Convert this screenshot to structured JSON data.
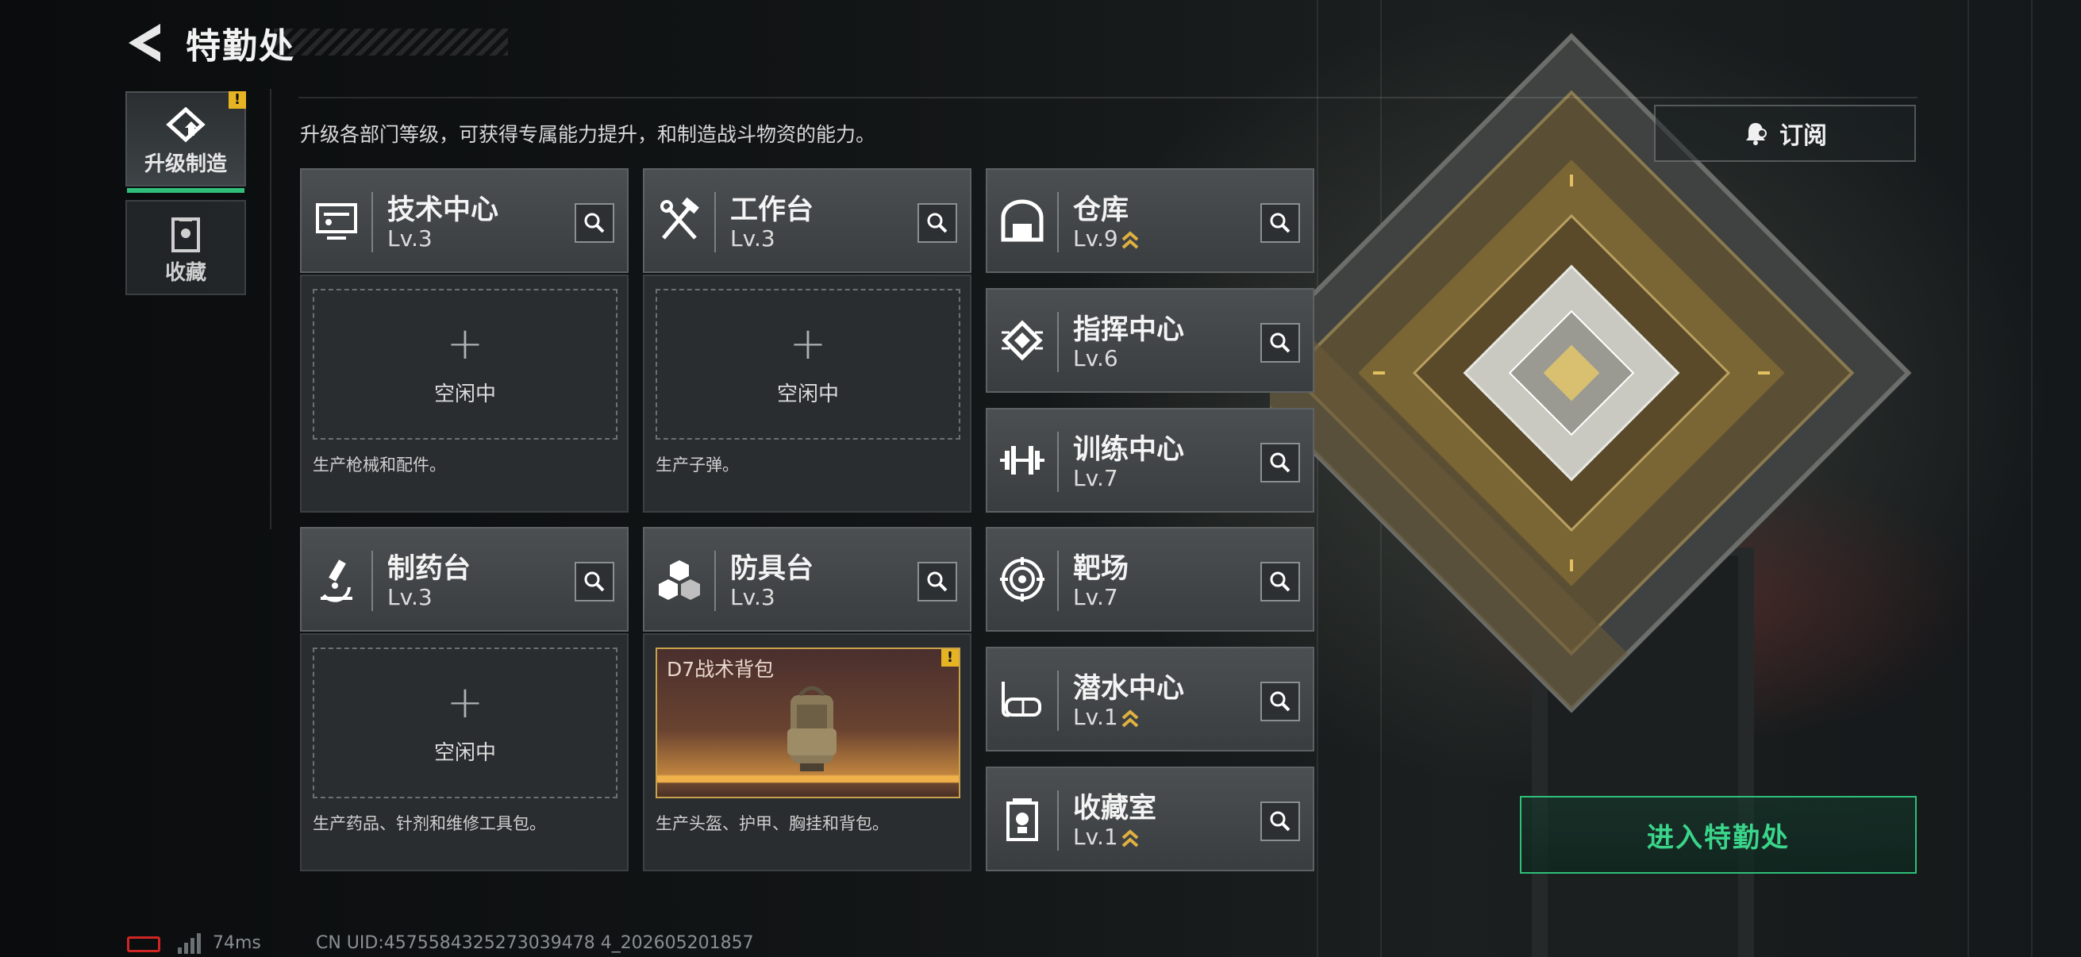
{
  "header": {
    "title": "特勤处"
  },
  "sidebar": {
    "tabs": [
      {
        "label": "升级制造",
        "active": true,
        "badge": "!"
      },
      {
        "label": "收藏",
        "active": false
      }
    ]
  },
  "main": {
    "description": "升级各部门等级，可获得专属能力提升，和制造战斗物资的能力。",
    "subscribe_label": "订阅",
    "enter_label": "进入特勤处",
    "workshops": [
      {
        "name": "技术中心",
        "level": "Lv.3",
        "slot": {
          "plus": "+",
          "status": "空闲中"
        },
        "desc": "生产枪械和配件。"
      },
      {
        "name": "工作台",
        "level": "Lv.3",
        "slot": {
          "plus": "+",
          "status": "空闲中"
        },
        "desc": "生产子弹。"
      },
      {
        "name": "制药台",
        "level": "Lv.3",
        "slot": {
          "plus": "+",
          "status": "空闲中"
        },
        "desc": "生产药品、针剂和维修工具包。"
      },
      {
        "name": "防具台",
        "level": "Lv.3",
        "item": {
          "name": "D7战术背包",
          "badge": "!"
        },
        "desc": "生产头盔、护甲、胸挂和背包。"
      }
    ],
    "facilities": [
      {
        "name": "仓库",
        "level": "Lv.9",
        "upgradable": true
      },
      {
        "name": "指挥中心",
        "level": "Lv.6",
        "upgradable": false
      },
      {
        "name": "训练中心",
        "level": "Lv.7",
        "upgradable": false
      },
      {
        "name": "靶场",
        "level": "Lv.7",
        "upgradable": false
      },
      {
        "name": "潜水中心",
        "level": "Lv.1",
        "upgradable": true
      },
      {
        "name": "收藏室",
        "level": "Lv.1",
        "upgradable": true
      }
    ]
  },
  "status_bar": {
    "ping": "74ms",
    "uid": "CN UID:4575584325273039478 4_202605201857"
  },
  "colors": {
    "accent_green": "#2fbf7a",
    "badge_yellow": "#e6b423",
    "upgrade_gold": "#e0b040"
  }
}
